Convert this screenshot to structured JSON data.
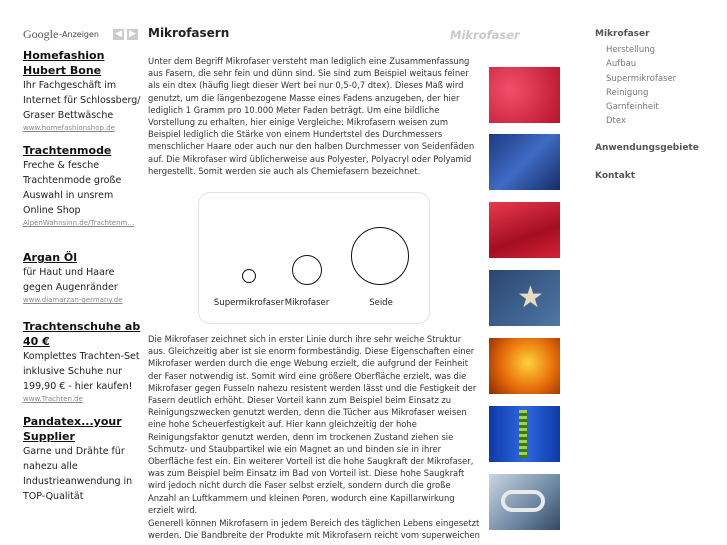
{
  "ads": {
    "google_logo": "Google",
    "google_label": "-Anzeigen",
    "prev_icon": "chevron-left-icon",
    "next_icon": "chevron-right-icon",
    "items": [
      {
        "title": "Homefashion Hubert Bone",
        "text": "Ihr Fachgeschäft im Internet für Schlossberg/ Graser Bettwäsche",
        "url": "www.homefashionshop.de"
      },
      {
        "title": "Trachtenmode",
        "text": "Freche & fesche Trachtenmode große Auswahl in unsrem Online Shop",
        "url": "AlpenWahnsinn.de/Trachtenm…"
      },
      {
        "title": "Argan Öl",
        "text": "für Haut und Haare gegen Augenränder",
        "url": "www.diamarzan-germany.de"
      },
      {
        "title": "Trachtenschuhe ab 40 €",
        "text": "Komplettes Trachten-Set inklusive Schuhe nur 199,90 € - hier kaufen!",
        "url": "www.Trachten.de"
      },
      {
        "title": "Pandatex...your Supplier",
        "text": "Garne und Drähte für nahezu alle Industrieanwendung in TOP-Qualität",
        "url": ""
      }
    ]
  },
  "main": {
    "title": "Mikrofasern",
    "watermark": "Mikrofaser",
    "p1": "Unter dem Begriff Mikrofaser versteht man lediglich eine Zusammenfassung aus Fasern, die sehr fein und dünn sind. Sie sind zum Beispiel weitaus feiner als ein dtex (häufig liegt dieser Wert bei nur 0,5-0,7 dtex). Dieses Maß wird genutzt, um die längenbezogene Masse eines Fadens anzugeben, der hier lediglich 1 Gramm pro 10.000 Meter Faden beträgt. Um eine bildliche Vorstellung zu erhalten, hier einige Vergleiche: Mikrofasern weisen zum Beispiel lediglich die Stärke von einem Hundertstel des Durchmessers menschlicher Haare oder auch nur den halben Durchmesser von Seidenfäden auf. Die Mikrofaser wird üblicherweise aus Polyester, Polyacryl oder Polyamid hergestellt. Somit werden sie auch als Chemiefasern bezeichnet.",
    "p2": "Die Mikrofaser zeichnet sich in erster Linie durch ihre sehr weiche Struktur aus. Gleichzeitig aber ist sie enorm formbeständig. Diese Eigenschaften einer Mikrofaser werden durch die enge Webung erzielt, die aufgrund der Feinheit der Faser notwendig ist. Somit wird eine größere Oberfläche erzielt, was die Mikrofaser gegen Fusseln nahezu resistent werden lässt und die Festigkeit der Fasern deutlich erhöht. Dieser Vorteil kann zum Beispiel beim Einsatz zu Reinigungszwecken genutzt werden, denn die Tücher aus Mikrofaser weisen eine hohe Scheuerfestigkeit auf. Hier kann gleichzeitig der hohe Reinigungsfaktor genutzt werden, denn im trockenen Zustand ziehen sie Schmutz- und Staubpartikel wie ein Magnet an und binden sie in ihrer Oberfläche fest ein. Ein weiterer Vorteil ist die hohe Saugkraft der Mikrofaser, was zum Beispiel beim Einsatz im Bad von Vorteil ist. Diese hohe Saugkraft wird jedoch nicht durch die Faser selbst erzielt, sondern durch die große Anzahl an Luftkammern und kleinen Poren, wodurch eine Kapillarwirkung erzielt wird.",
    "p3": "Generell können Mikrofasern in jedem Bereich des täglichen Lebens eingesetzt werden. Die Bandbreite der Produkte mit Mikrofasern reicht vom superweichen",
    "diagram": {
      "labels": [
        "Supermikrofaser",
        "Mikrofaser",
        "Seide"
      ]
    }
  },
  "thumbs": [
    {
      "name": "red-glitter-thumbnail",
      "color": "#d5213a"
    },
    {
      "name": "blue-fabric-thumbnail",
      "color": "#2b4fa0"
    },
    {
      "name": "red-satin-thumbnail",
      "color": "#c4162a"
    },
    {
      "name": "star-zipper-thumbnail",
      "color": "#3a5b8a"
    },
    {
      "name": "orange-fiber-thumbnail",
      "color": "#e06a10"
    },
    {
      "name": "zipper-blue-thumbnail",
      "color": "#1c4bb8"
    },
    {
      "name": "goggles-thumbnail",
      "color": "#8aa0b8"
    }
  ],
  "nav": {
    "section1": "Mikrofaser",
    "sub": [
      "Herstellung",
      "Aufbau",
      "Supermikrofaser",
      "Reinigung",
      "Garnfeinheit",
      "Dtex"
    ],
    "section2": "Anwendungsgebiete",
    "section3": "Kontakt"
  }
}
